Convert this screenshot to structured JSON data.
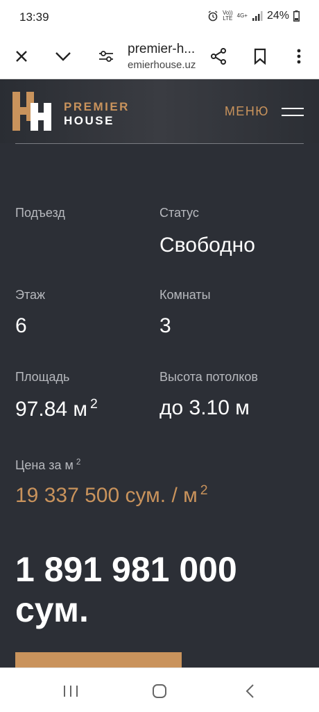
{
  "status_bar": {
    "time": "13:39",
    "network_line1": "Vo))",
    "network_line2": "LTE",
    "net_type": "4G+",
    "battery": "24%"
  },
  "browser": {
    "title": "premier-h...",
    "domain": "emierhouse.uz"
  },
  "site": {
    "logo_line1": "PREMIER",
    "logo_line2": "HOUSE",
    "menu_label": "МЕНЮ",
    "accent_color": "#c9935c",
    "background_color": "#2c2f36"
  },
  "details": {
    "entrance_label": "Подъезд",
    "status_label": "Статус",
    "status_value": "Свободно",
    "floor_label": "Этаж",
    "floor_value": "6",
    "rooms_label": "Комнаты",
    "rooms_value": "3",
    "area_label": "Площадь",
    "area_value": "97.84 м",
    "area_sup": "2",
    "ceiling_label": "Высота потолков",
    "ceiling_value": "до 3.10 м",
    "price_label": "Цена за м",
    "price_label_sup": "2",
    "price_per_m2": "19 337 500 сум. / м",
    "price_per_m2_sup": "2",
    "total_price": "1 891 981 000 сум."
  }
}
